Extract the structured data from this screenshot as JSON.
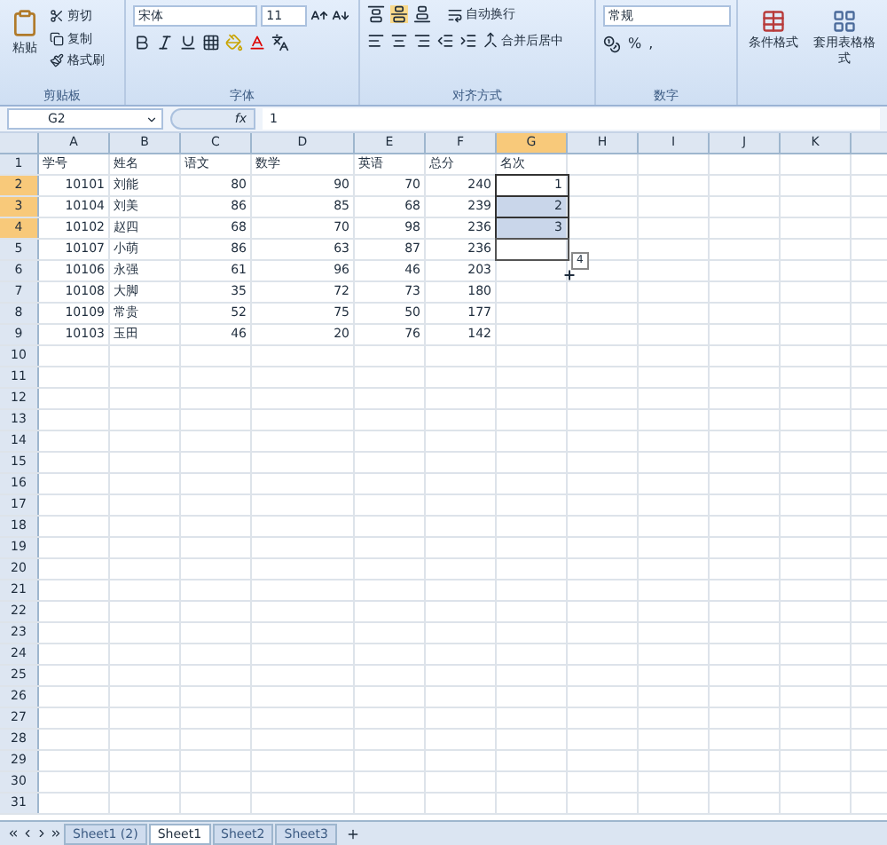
{
  "ribbon": {
    "clipboard": {
      "paste": "粘贴",
      "cut": "剪切",
      "copy": "复制",
      "painter": "格式刷",
      "label": "剪贴板"
    },
    "font": {
      "name": "宋体",
      "size": "11",
      "label": "字体"
    },
    "alignment": {
      "wrap": "自动换行",
      "merge": "合并后居中",
      "label": "对齐方式"
    },
    "number": {
      "format": "常规",
      "percent": "%",
      "comma": ",",
      "label": "数字"
    },
    "styles": {
      "conditional": "条件格式",
      "table": "套用表格格式"
    }
  },
  "formula_bar": {
    "name_box": "G2",
    "fx": "fx",
    "value": "1"
  },
  "columns": [
    {
      "label": "A",
      "selected": false
    },
    {
      "label": "B",
      "selected": false
    },
    {
      "label": "C",
      "selected": false
    },
    {
      "label": "D",
      "selected": false
    },
    {
      "label": "E",
      "selected": false
    },
    {
      "label": "F",
      "selected": false
    },
    {
      "label": "G",
      "selected": true
    },
    {
      "label": "H",
      "selected": false
    },
    {
      "label": "I",
      "selected": false
    },
    {
      "label": "J",
      "selected": false
    },
    {
      "label": "K",
      "selected": false
    }
  ],
  "rows": [
    {
      "label": "1",
      "selected": false,
      "cells": [
        "学号",
        "姓名",
        "语文",
        "数学",
        "英语",
        "总分",
        "名次"
      ]
    },
    {
      "label": "2",
      "selected": true,
      "cells": [
        "10101",
        "刘能",
        "80",
        "90",
        "70",
        "240",
        "1"
      ]
    },
    {
      "label": "3",
      "selected": true,
      "cells": [
        "10104",
        "刘美",
        "86",
        "85",
        "68",
        "239",
        "2"
      ]
    },
    {
      "label": "4",
      "selected": true,
      "cells": [
        "10102",
        "赵四",
        "68",
        "70",
        "98",
        "236",
        "3"
      ]
    },
    {
      "label": "5",
      "selected": false,
      "fill_target": true,
      "cells": [
        "10107",
        "小萌",
        "86",
        "63",
        "87",
        "236"
      ]
    },
    {
      "label": "6",
      "selected": false,
      "cells": [
        "10106",
        "永强",
        "61",
        "96",
        "46",
        "203"
      ]
    },
    {
      "label": "7",
      "selected": false,
      "cells": [
        "10108",
        "大脚",
        "35",
        "72",
        "73",
        "180"
      ]
    },
    {
      "label": "8",
      "selected": false,
      "cells": [
        "10109",
        "常贵",
        "52",
        "75",
        "50",
        "177"
      ]
    },
    {
      "label": "9",
      "selected": false,
      "cells": [
        "10103",
        "玉田",
        "46",
        "20",
        "76",
        "142"
      ]
    },
    {
      "label": "10",
      "selected": false,
      "cells": []
    },
    {
      "label": "11",
      "selected": false,
      "cells": []
    },
    {
      "label": "12",
      "selected": false,
      "cells": []
    },
    {
      "label": "13",
      "selected": false,
      "cells": []
    },
    {
      "label": "14",
      "selected": false,
      "cells": []
    },
    {
      "label": "15",
      "selected": false,
      "cells": []
    },
    {
      "label": "16",
      "selected": false,
      "cells": []
    },
    {
      "label": "17",
      "selected": false,
      "cells": []
    },
    {
      "label": "18",
      "selected": false,
      "cells": []
    },
    {
      "label": "19",
      "selected": false,
      "cells": []
    },
    {
      "label": "20",
      "selected": false,
      "cells": []
    },
    {
      "label": "21",
      "selected": false,
      "cells": []
    },
    {
      "label": "22",
      "selected": false,
      "cells": []
    },
    {
      "label": "23",
      "selected": false,
      "cells": []
    },
    {
      "label": "24",
      "selected": false,
      "cells": []
    },
    {
      "label": "25",
      "selected": false,
      "cells": []
    },
    {
      "label": "26",
      "selected": false,
      "cells": []
    },
    {
      "label": "27",
      "selected": false,
      "cells": []
    },
    {
      "label": "28",
      "selected": false,
      "cells": []
    },
    {
      "label": "29",
      "selected": false,
      "cells": []
    },
    {
      "label": "30",
      "selected": false,
      "cells": []
    },
    {
      "label": "31",
      "selected": false,
      "cells": []
    }
  ],
  "fill_tooltip": "4",
  "sheet_tabs": [
    {
      "label": "Sheet1 (2)",
      "selected": false
    },
    {
      "label": "Sheet1",
      "selected": true
    },
    {
      "label": "Sheet2",
      "selected": false
    },
    {
      "label": "Sheet3",
      "selected": false
    }
  ]
}
